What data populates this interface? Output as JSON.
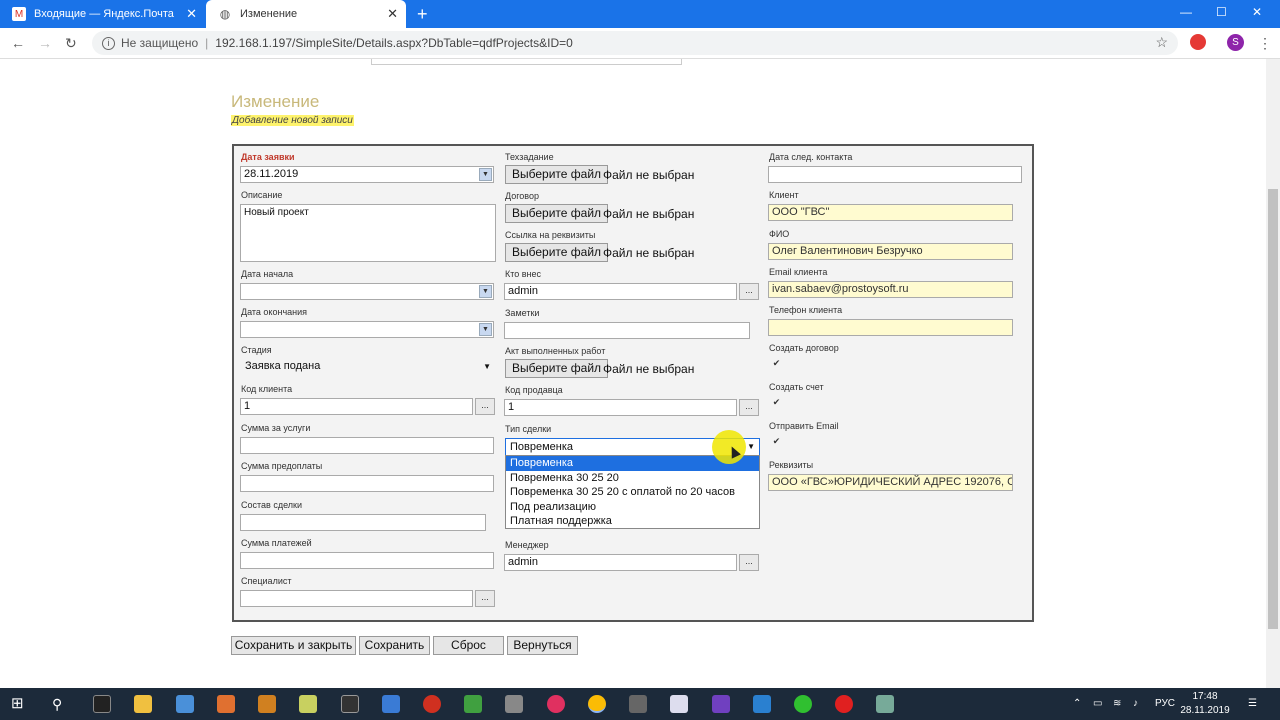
{
  "browser": {
    "tabs": [
      {
        "label": "Входящие — Яндекс.Почта",
        "icon": "gmail-icon"
      },
      {
        "label": "Изменение",
        "icon": "globe-icon"
      }
    ],
    "security_label": "Не защищено",
    "url": "192.168.1.197/SimpleSite/Details.aspx?DbTable=qdfProjects&ID=0",
    "avatar_letter": "S"
  },
  "header": {
    "title": "Изменение",
    "subtitle": "Добавление новой записи"
  },
  "form": {
    "col1": {
      "date_label": "Дата заявки",
      "date_value": "28.11.2019",
      "description_label": "Описание",
      "description_value": "Новый  проект",
      "start_label": "Дата начала",
      "start_value": "",
      "end_label": "Дата окончания",
      "end_value": "",
      "stage_label": "Стадия",
      "stage_value": "Заявка подана",
      "client_code_label": "Код клиента",
      "client_code_value": "1",
      "service_sum_label": "Сумма за услуги",
      "prepay_sum_label": "Сумма предоплаты",
      "deal_label": "Состав сделки",
      "payments_label": "Сумма платежей",
      "specialist_label": "Специалист"
    },
    "col2": {
      "tz_label": "Техзадание",
      "contract_label": "Договор",
      "requisites_link_label": "Ссылка на реквизиты",
      "file_button": "Выберите файл",
      "file_none": "Файл не выбран",
      "author_label": "Кто внес",
      "author_value": "admin",
      "notes_label": "Заметки",
      "act_label": "Акт выполненных работ",
      "seller_code_label": "Код продавца",
      "seller_code_value": "1",
      "deal_type_label": "Тип сделки",
      "deal_type_value": "Повременка",
      "deal_type_options": [
        "Повременка",
        "Повременка 30 25 20",
        "Повременка 30 25 20 с оплатой по 20 часов",
        "Под реализацию",
        "Платная поддержка"
      ],
      "manager_label": "Менеджер",
      "manager_value": "admin"
    },
    "col3": {
      "next_contact_label": "Дата след. контакта",
      "client_label": "Клиент",
      "client_value": "ООО \"ГВС\"",
      "fio_label": "ФИО",
      "fio_value": "Олег Валентинович Безручко",
      "email_label": "Email клиента",
      "email_value": "ivan.sabaev@prostoysoft.ru",
      "phone_label": "Телефон клиента",
      "create_contract_label": "Создать договор",
      "create_invoice_label": "Создать счет",
      "send_email_label": "Отправить Email",
      "requisites_label": "Реквизиты",
      "requisites_value": "ООО «ГВС»ЮРИДИЧЕСКИЙ АДРЕС 192076, С"
    },
    "dots_label": "..."
  },
  "actions": {
    "save_close": "Сохранить и закрыть",
    "save": "Сохранить",
    "reset": "Сброс",
    "back": "Вернуться"
  },
  "taskbar": {
    "lang": "РУС",
    "time": "17:48",
    "date": "28.11.2019"
  }
}
